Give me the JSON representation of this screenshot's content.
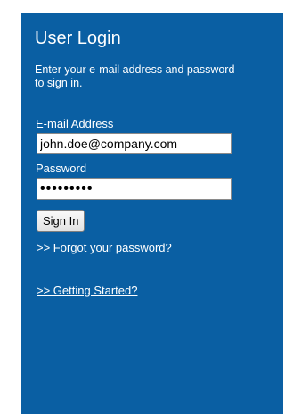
{
  "login": {
    "title": "User Login",
    "instructions_line1": "Enter your e-mail address and password",
    "instructions_line2": "to sign in.",
    "email_label": "E-mail Address",
    "email_value": "john.doe@company.com",
    "password_label": "Password",
    "password_value": "•••••••••",
    "sign_in_label": "Sign In",
    "forgot_link": ">> Forgot your password?",
    "getting_started_link": ">> Getting Started?"
  },
  "colors": {
    "panel_background": "#0a5fa3",
    "text": "#ffffff"
  }
}
